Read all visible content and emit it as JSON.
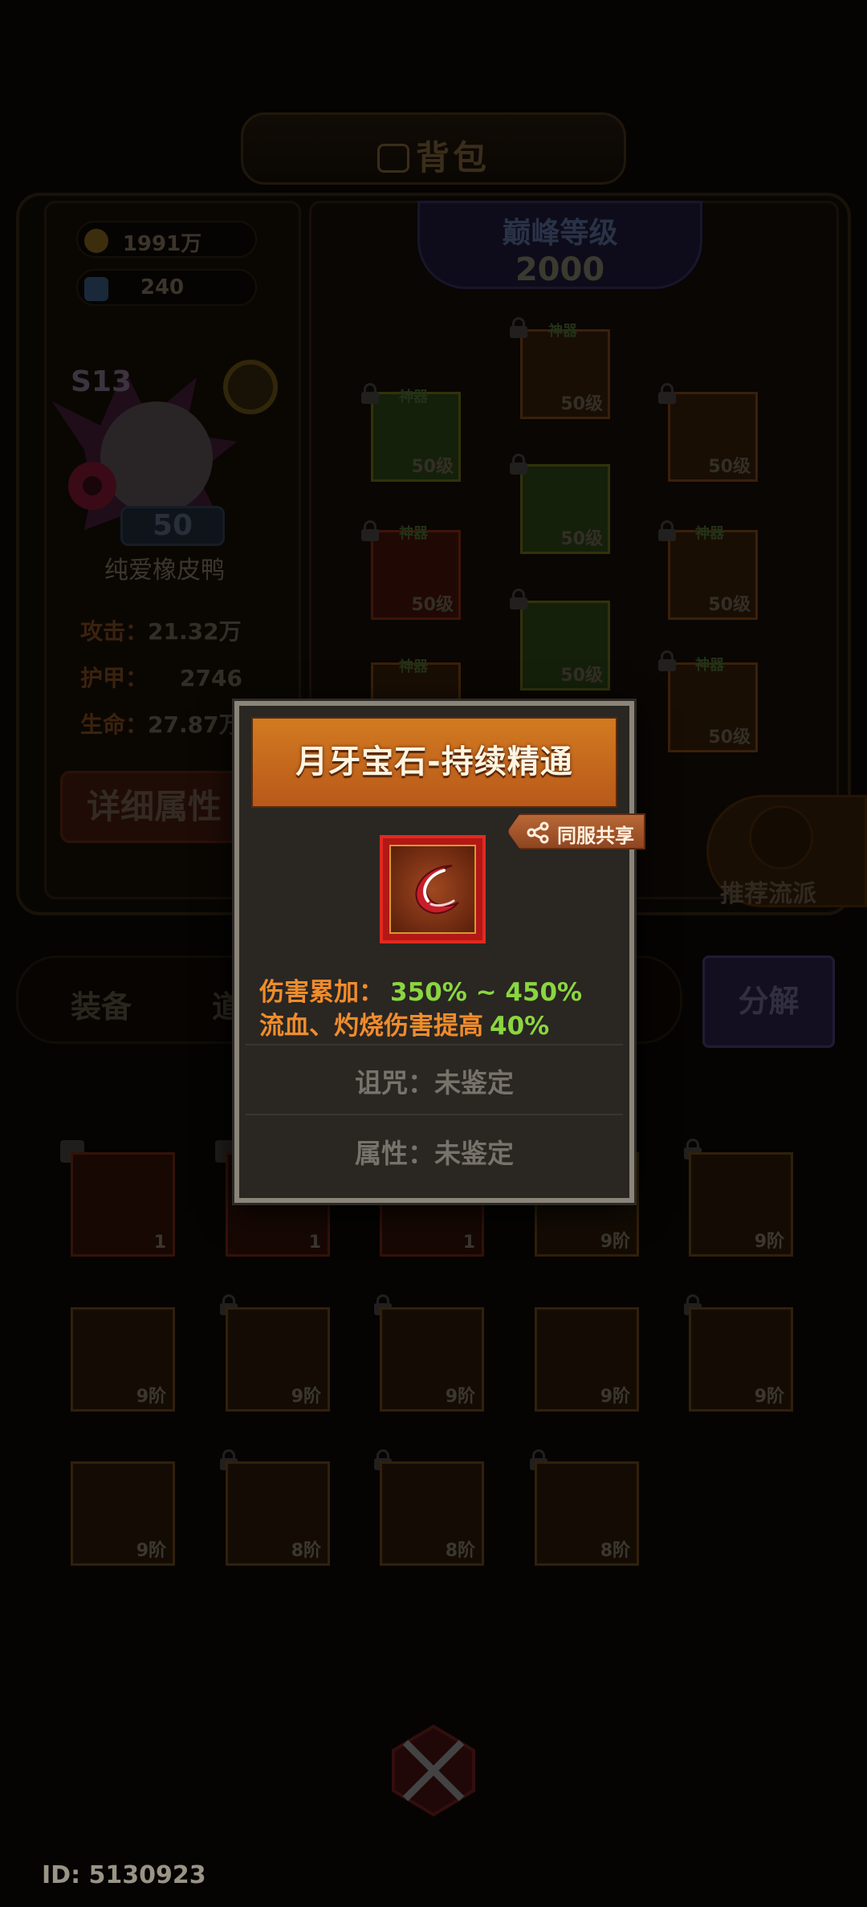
{
  "header": {
    "title": "背包"
  },
  "currency": [
    {
      "icon": "gold-coin-icon",
      "value": "1991万"
    },
    {
      "icon": "gem-icon",
      "value": "240"
    }
  ],
  "hero": {
    "season": "S13",
    "level": "50",
    "name": "纯爱橡皮鸭",
    "stats": [
      {
        "label": "攻击：",
        "value": "21.32万"
      },
      {
        "label": "护甲：",
        "value": "2746"
      },
      {
        "label": "生命：",
        "value": "27.87万"
      }
    ],
    "detail_button": "详细属性"
  },
  "peak": {
    "label": "巅峰等级",
    "value": "2000"
  },
  "equipment": {
    "tag": "神器",
    "slot_level": "50级"
  },
  "recommend_label": "推荐流派",
  "tabs": {
    "equip": "装备",
    "items": "道具"
  },
  "decompose_label": "分解",
  "inventory": [
    [
      "1",
      "1",
      "1",
      "9阶",
      "9阶"
    ],
    [
      "9阶",
      "9阶",
      "9阶",
      "9阶",
      "9阶"
    ],
    [
      "9阶",
      "8阶",
      "8阶",
      "8阶"
    ]
  ],
  "footer": {
    "id_text": "ID: 5130923"
  },
  "popup": {
    "title": "月牙宝石-持续精通",
    "share_label": "同服共享",
    "effect1_label": "伤害累加：",
    "effect1_value": "350% ~ 450%",
    "effect2_label": "流血、灼烧伤害提高",
    "effect2_value": "40%",
    "curse": "诅咒：未鉴定",
    "attribute": "属性：未鉴定"
  }
}
